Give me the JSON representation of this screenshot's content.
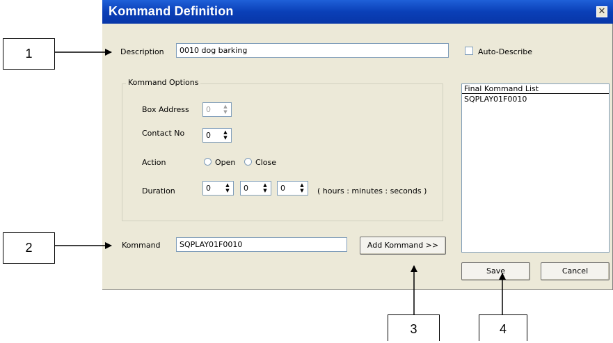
{
  "window": {
    "title": "Kommand Definition",
    "close_icon": "close-icon"
  },
  "description": {
    "label": "Description",
    "value": "0010  dog barking"
  },
  "auto_describe": {
    "label": "Auto-Describe",
    "checked": false
  },
  "kommand_options": {
    "group_label": "Kommand Options",
    "box_address": {
      "label": "Box Address",
      "value": "0",
      "enabled": false
    },
    "contact_no": {
      "label": "Contact No",
      "value": "0"
    },
    "action": {
      "label": "Action",
      "open_label": "Open",
      "close_label": "Close"
    },
    "duration": {
      "label": "Duration",
      "hours": "0",
      "minutes": "0",
      "seconds": "0",
      "hint": "( hours : minutes : seconds )"
    }
  },
  "kommand": {
    "label": "Kommand",
    "value": "SQPLAY01F0010"
  },
  "add_button_label": "Add Kommand >>",
  "final_list": {
    "header": "Final Kommand List",
    "items": [
      "SQPLAY01F0010"
    ]
  },
  "save_label": "Save",
  "cancel_label": "Cancel",
  "callouts": [
    "1",
    "2",
    "3",
    "4"
  ],
  "colors": {
    "titlebar": "#0a3fb7",
    "dialog_bg": "#ece9d8"
  }
}
